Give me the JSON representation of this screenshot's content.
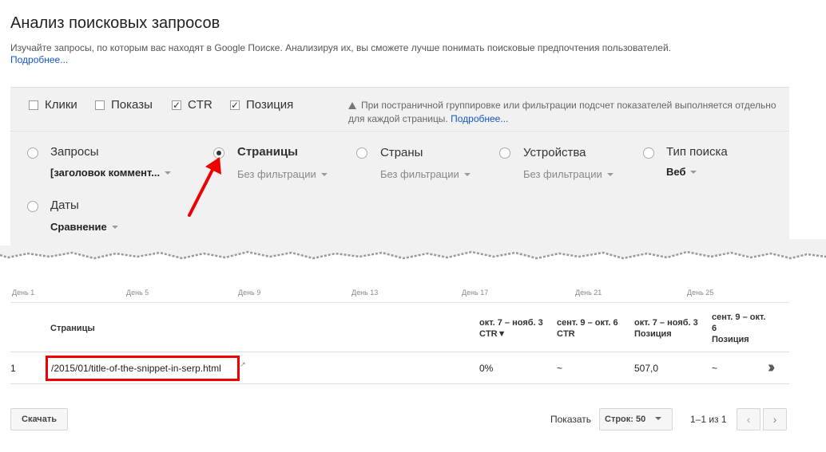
{
  "header": {
    "title": "Анализ поисковых запросов",
    "description": "Изучайте запросы, по которым вас находят в Google Поиске. Анализируя их, вы сможете лучше понимать поисковые предпочтения пользователей.",
    "more_link": "Подробнее..."
  },
  "metrics": [
    {
      "label": "Клики",
      "checked": false,
      "mark": ""
    },
    {
      "label": "Показы",
      "checked": false,
      "mark": ""
    },
    {
      "label": "CTR",
      "checked": true,
      "mark": "✓"
    },
    {
      "label": "Позиция",
      "checked": true,
      "mark": "✓"
    }
  ],
  "note": {
    "text": "При постраничной группировке или фильтрации подсчет показателей выполняется отдельно для каждой страницы.",
    "link": "Подробнее..."
  },
  "dimensions": [
    {
      "label": "Запросы",
      "selected": false,
      "sub": "[заголовок коммент...",
      "sub_bold": true
    },
    {
      "label": "Страницы",
      "selected": true,
      "sub": "Без фильтрации",
      "sub_bold": false
    },
    {
      "label": "Страны",
      "selected": false,
      "sub": "Без фильтрации",
      "sub_bold": false
    },
    {
      "label": "Устройства",
      "selected": false,
      "sub": "Без фильтрации",
      "sub_bold": false
    },
    {
      "label": "Тип поиска",
      "selected": false,
      "sub": "Веб",
      "sub_bold": true
    },
    {
      "label": "Даты",
      "selected": false,
      "sub": "Сравнение",
      "sub_bold": true
    }
  ],
  "chart_axis": {
    "day_labels": [
      "День 1",
      "День 5",
      "День 9",
      "День 13",
      "День 17",
      "День 21",
      "День 25"
    ]
  },
  "table": {
    "headers": {
      "page": "Страницы",
      "col1_period": "окт. 7 – нояб. 3",
      "col1_metric": "CTR▼",
      "col2_period": "сент. 9 – окт. 6",
      "col2_metric": "CTR",
      "col3_period": "окт. 7 – нояб. 3",
      "col3_metric": "Позиция",
      "col4_period": "сент. 9 – окт. 6",
      "col4_metric": "Позиция"
    },
    "rows": [
      {
        "index": "1",
        "page": "/2015/01/title-of-the-snippet-in-serp.html",
        "ctr_current": "0%",
        "ctr_previous": "~",
        "pos_current": "507,0",
        "pos_previous": "~"
      }
    ]
  },
  "footer": {
    "download_label": "Скачать",
    "show_label": "Показать",
    "rows_select": "Строк: 50",
    "range": "1–1 из 1",
    "prev": "‹",
    "next": "›"
  },
  "colors": {
    "panel_bg": "#f1f1f1",
    "link": "#1155cc",
    "highlight": "#ee0000"
  }
}
